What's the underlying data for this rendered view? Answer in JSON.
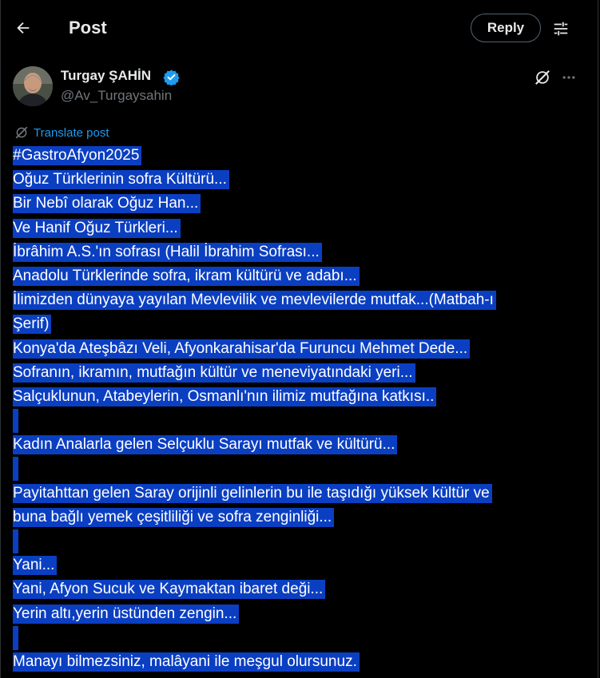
{
  "header": {
    "title": "Post",
    "reply_label": "Reply"
  },
  "icons": {
    "back": "arrow-left-icon",
    "filter": "sliders-icon",
    "verified": "verified-badge-icon",
    "grok": "grok-icon",
    "more": "more-dots-icon",
    "translate": "grok-icon"
  },
  "author": {
    "name": "Turgay ŞAHİN",
    "handle": "@Av_Turgaysahin"
  },
  "post": {
    "translate_label": "Translate post",
    "lines": [
      "#GastroAfyon2025",
      "Oğuz Türklerinin sofra Kültürü...",
      "Bir Nebî olarak Oğuz Han...",
      "Ve Hanif Oğuz Türkleri...",
      "İbrâhim A.S.'ın sofrası (Halil İbrahim Sofrası...",
      "Anadolu Türklerinde sofra, ikram kültürü ve adabı...",
      "İlimizden dünyaya yayılan Mevlevilik ve mevlevilerde mutfak...(Matbah-ı",
      "Şerif)",
      "Konya'da Ateşbâzı Veli, Afyonkarahisar'da Furuncu Mehmet Dede...",
      "Sofranın, ikramın, mutfağın kültür ve meneviyatındaki yeri...",
      "Salçuklunun, Atabeylerin, Osmanlı'nın ilimiz mutfağına katkısı..",
      "",
      "Kadın Analarla gelen Selçuklu Sarayı mutfak ve kültürü...",
      "",
      "Payitahttan gelen Saray orijinli gelinlerin bu ile taşıdığı yüksek kültür ve",
      "buna bağlı yemek çeşitliliği ve sofra zenginliği...",
      "",
      "Yani...",
      "Yani, Afyon Sucuk ve Kaymaktan ibaret deği...",
      "Yerin altı,yerin üstünden zengin...",
      "",
      "Manayı bilmezsiniz, malâyani ile meşgul olursunuz."
    ]
  },
  "colors": {
    "background": "#000000",
    "selection": "#0b3fc2",
    "link": "#1d9bf0",
    "verified": "#1d9bf0",
    "muted": "#71767b"
  }
}
